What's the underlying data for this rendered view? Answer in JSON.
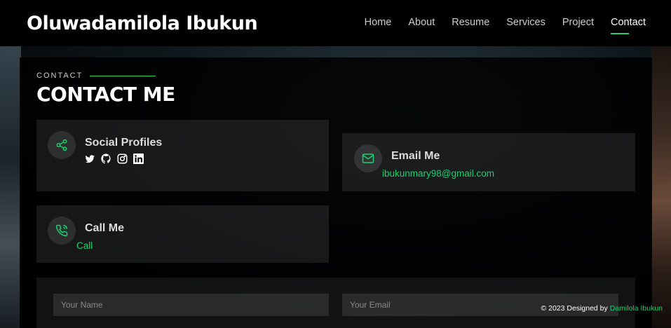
{
  "header": {
    "logo": "Oluwadamilola Ibukun",
    "nav": [
      {
        "label": "Home",
        "active": false
      },
      {
        "label": "About",
        "active": false
      },
      {
        "label": "Resume",
        "active": false
      },
      {
        "label": "Services",
        "active": false
      },
      {
        "label": "Project",
        "active": false
      },
      {
        "label": "Contact",
        "active": true
      }
    ]
  },
  "section": {
    "label": "CONTACT",
    "title": "CONTACT ME"
  },
  "cards": {
    "social": {
      "title": "Social Profiles",
      "icons": [
        "twitter-icon",
        "github-icon",
        "instagram-icon",
        "linkedin-icon"
      ]
    },
    "email": {
      "title": "Email Me",
      "value": "ibukunmary98@gmail.com"
    },
    "call": {
      "title": "Call Me",
      "value": "Call"
    }
  },
  "form": {
    "name_placeholder": "Your Name",
    "email_placeholder": "Your Email"
  },
  "footer": {
    "prefix": "© 2023 Designed by",
    "author": "Damilola Ibukun"
  },
  "colors": {
    "accent": "#18d26e",
    "background": "#050709"
  }
}
